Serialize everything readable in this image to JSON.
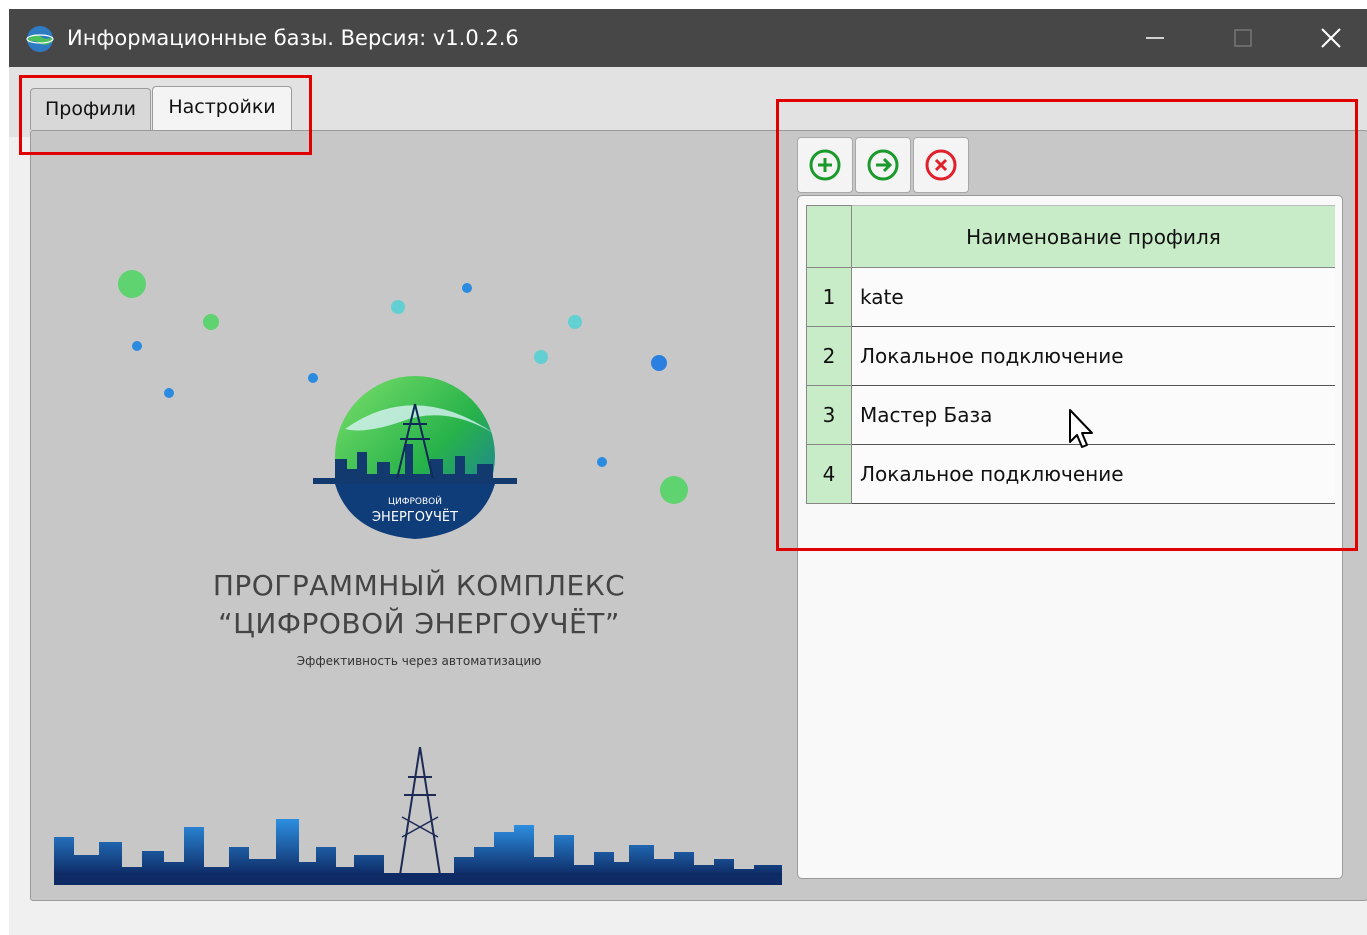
{
  "window": {
    "title": "Информационные базы. Версия: v1.0.2.6",
    "controls": {
      "minimize": "minimize-icon",
      "maximize": "maximize-icon",
      "close": "close-icon"
    }
  },
  "tabs": [
    {
      "label": "Профили",
      "active": true
    },
    {
      "label": "Настройки",
      "active": false
    }
  ],
  "branding": {
    "logo_line1": "ЦИФРОВОЙ",
    "logo_line2": "ЭНЕРГОУЧЁТ",
    "title_line1": "ПРОГРАММНЫЙ КОМПЛЕКС",
    "title_line2": "“ЦИФРОВОЙ ЭНЕРГОУЧЁТ”",
    "subtitle": "Эффективность через автоматизацию"
  },
  "toolbar": {
    "add_icon": "plus-circle-icon",
    "open_icon": "arrow-right-circle-icon",
    "delete_icon": "x-circle-icon"
  },
  "profiles_table": {
    "column_header": "Наименование профиля",
    "rows": [
      {
        "num": "1",
        "name": "kate"
      },
      {
        "num": "2",
        "name": "Локальное подключение"
      },
      {
        "num": "3",
        "name": "Мастер База"
      },
      {
        "num": "4",
        "name": "Локальное подключение"
      }
    ]
  },
  "colors": {
    "titlebar": "#474747",
    "panel": "#c7c7c7",
    "header_green": "#c8ebc8",
    "add_green": "#1a9a2a",
    "delete_red": "#e0202a",
    "highlight_red": "#e00000"
  }
}
